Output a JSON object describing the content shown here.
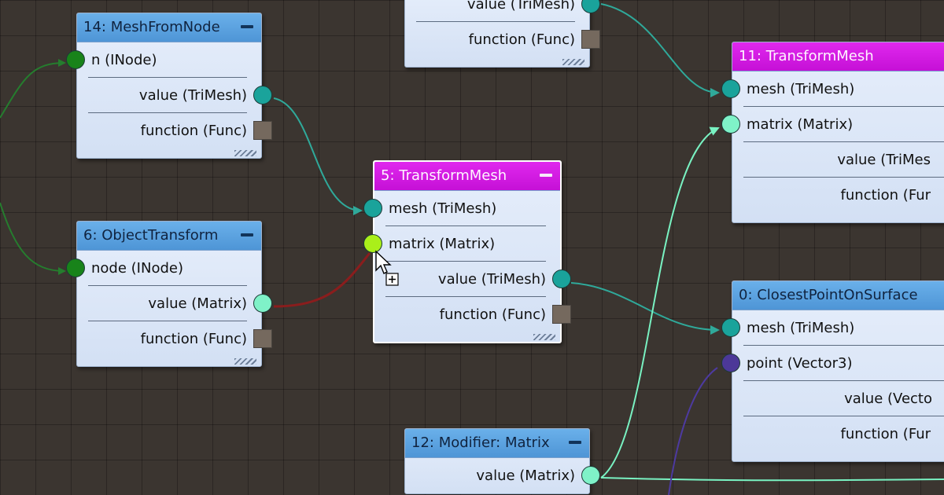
{
  "colors": {
    "canvas": "#3b3530",
    "header_blue": "#5aa3e0",
    "header_magenta": "#d61ce4",
    "teal_port": "#1aa39b",
    "mint_port": "#7ff2c8",
    "green_port": "#18831a",
    "lime_port": "#aaef1a",
    "violet_port": "#4c3898",
    "func_port": "#75695e",
    "wire_teal": "#2fa99a",
    "wire_mint": "#79f2c2",
    "wire_green": "#257d2e",
    "wire_red": "#8a1d1d",
    "wire_violet": "#4d3aa0"
  },
  "nodes": {
    "n_top": {
      "title": "",
      "ports": [
        {
          "label": "value (TriMesh)",
          "dir": "out",
          "port": "teal"
        },
        {
          "label": "function (Func)",
          "dir": "out",
          "port": "func"
        }
      ]
    },
    "n14": {
      "title": "14: MeshFromNode",
      "ports": [
        {
          "label": "n (INode)",
          "dir": "in",
          "port": "green"
        },
        {
          "label": "value (TriMesh)",
          "dir": "out",
          "port": "teal"
        },
        {
          "label": "function (Func)",
          "dir": "out",
          "port": "func"
        }
      ]
    },
    "n6": {
      "title": "6: ObjectTransform",
      "ports": [
        {
          "label": "node (INode)",
          "dir": "in",
          "port": "green"
        },
        {
          "label": "value (Matrix)",
          "dir": "out",
          "port": "mint"
        },
        {
          "label": "function (Func)",
          "dir": "out",
          "port": "func"
        }
      ]
    },
    "n5": {
      "title": "5: TransformMesh",
      "ports": [
        {
          "label": "mesh (TriMesh)",
          "dir": "in",
          "port": "teal"
        },
        {
          "label": "matrix (Matrix)",
          "dir": "in",
          "port": "lime"
        },
        {
          "label": "value (TriMesh)",
          "dir": "out",
          "port": "teal"
        },
        {
          "label": "function (Func)",
          "dir": "out",
          "port": "func"
        }
      ]
    },
    "n11": {
      "title": "11: TransformMesh",
      "ports": [
        {
          "label": "mesh (TriMesh)",
          "dir": "in",
          "port": "teal"
        },
        {
          "label": "matrix (Matrix)",
          "dir": "in",
          "port": "mint"
        },
        {
          "label": "value (TriMes",
          "dir": "out",
          "port": "none"
        },
        {
          "label": "function (Fur",
          "dir": "out",
          "port": "none"
        }
      ]
    },
    "n0": {
      "title": "0: ClosestPointOnSurface",
      "ports": [
        {
          "label": "mesh (TriMesh)",
          "dir": "in",
          "port": "teal"
        },
        {
          "label": "point (Vector3)",
          "dir": "in",
          "port": "violet"
        },
        {
          "label": "value (Vecto",
          "dir": "out",
          "port": "none"
        },
        {
          "label": "function (Fur",
          "dir": "out",
          "port": "none"
        }
      ]
    },
    "n12": {
      "title": "12: Modifier: Matrix",
      "ports": [
        {
          "label": "value (Matrix)",
          "dir": "out",
          "port": "mint"
        }
      ]
    }
  },
  "icons": {
    "cursor": "arrow-cursor-with-plus-icon"
  }
}
